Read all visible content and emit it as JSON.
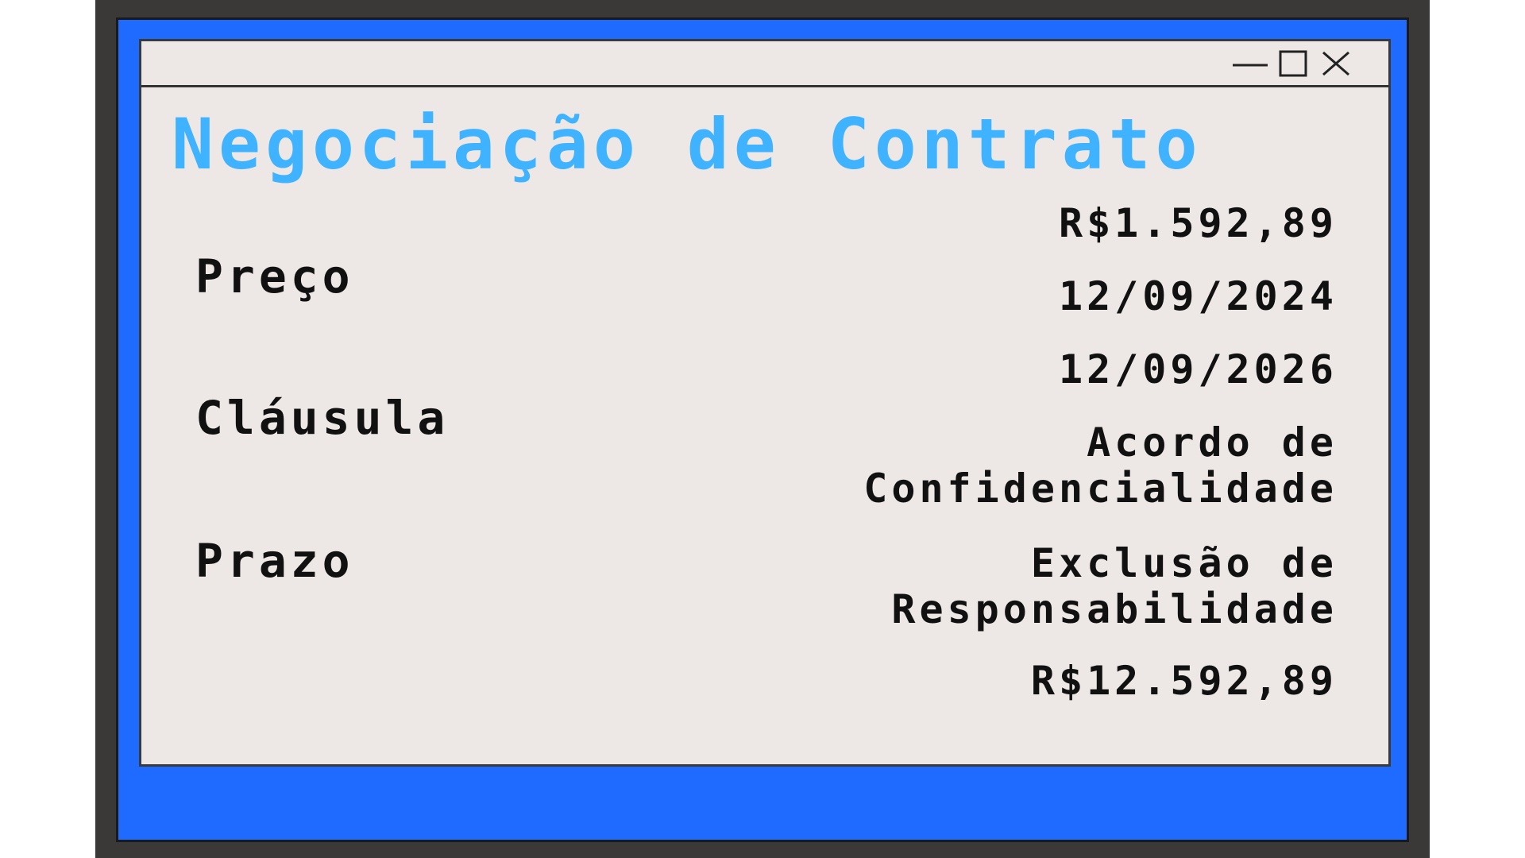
{
  "window": {
    "title": "Negociação de Contrato",
    "controls": {
      "minimize_icon": "minimize-icon",
      "maximize_icon": "maximize-icon",
      "close_icon": "close-icon"
    }
  },
  "labels": {
    "price": "Preço",
    "clause": "Cláusula",
    "term": "Prazo"
  },
  "values": {
    "price_small": "R$1.592,89",
    "date_start": "12/09/2024",
    "date_end": "12/09/2026",
    "clause_confidentiality": "Acordo de Confidencialidade",
    "clause_liability": "Exclusão de Responsabilidade",
    "price_large": "R$12.592,89"
  },
  "colors": {
    "frame_dark": "#3b3838",
    "frame_blue": "#1f6bff",
    "window_bg": "#ede8e6",
    "title_accent": "#3fb3ff",
    "text": "#111111"
  }
}
